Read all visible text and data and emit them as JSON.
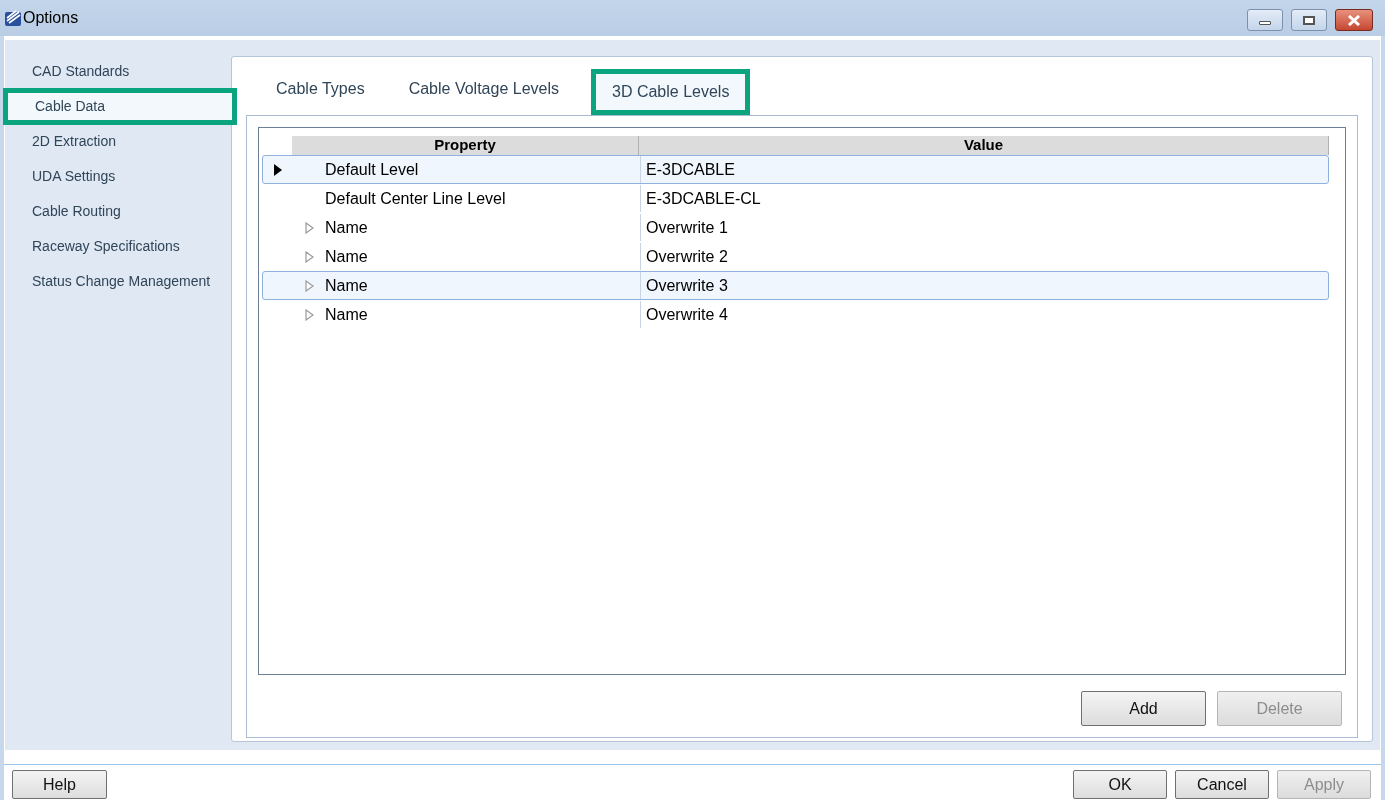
{
  "window": {
    "title": "Options"
  },
  "sidebar": {
    "items": [
      {
        "label": "CAD Standards",
        "selected": false
      },
      {
        "label": "Cable Data",
        "selected": true
      },
      {
        "label": "2D Extraction",
        "selected": false
      },
      {
        "label": "UDA Settings",
        "selected": false
      },
      {
        "label": "Cable Routing",
        "selected": false
      },
      {
        "label": "Raceway Specifications",
        "selected": false
      },
      {
        "label": "Status Change Management",
        "selected": false
      }
    ]
  },
  "tabs": [
    {
      "label": "Cable Types",
      "selected": false
    },
    {
      "label": "Cable Voltage Levels",
      "selected": false
    },
    {
      "label": "3D Cable Levels",
      "selected": true
    }
  ],
  "table": {
    "columns": [
      "Property",
      "Value"
    ],
    "rows": [
      {
        "property": "Default Level",
        "value": "E-3DCABLE",
        "current": true,
        "expandable": false,
        "selected": true
      },
      {
        "property": "Default Center Line Level",
        "value": "E-3DCABLE-CL",
        "current": false,
        "expandable": false,
        "selected": false
      },
      {
        "property": "Name",
        "value": "Overwrite 1",
        "current": false,
        "expandable": true,
        "selected": false
      },
      {
        "property": "Name",
        "value": "Overwrite 2",
        "current": false,
        "expandable": true,
        "selected": false
      },
      {
        "property": "Name",
        "value": "Overwrite 3",
        "current": false,
        "expandable": true,
        "selected": true
      },
      {
        "property": "Name",
        "value": "Overwrite 4",
        "current": false,
        "expandable": true,
        "selected": false
      }
    ]
  },
  "panel_buttons": [
    {
      "label": "Add",
      "disabled": false
    },
    {
      "label": "Delete",
      "disabled": true
    }
  ],
  "help_button": {
    "label": "Help",
    "disabled": false
  },
  "dialog_buttons": [
    {
      "label": "OK",
      "disabled": false
    },
    {
      "label": "Cancel",
      "disabled": false
    },
    {
      "label": "Apply",
      "disabled": true
    }
  ]
}
